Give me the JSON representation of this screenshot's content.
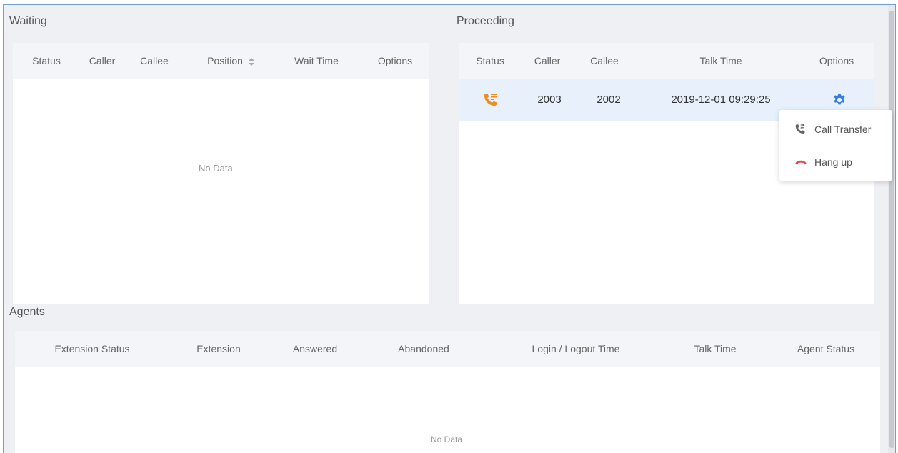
{
  "waiting": {
    "title": "Waiting",
    "columns": [
      "Status",
      "Caller",
      "Callee",
      "Position",
      "Wait Time",
      "Options"
    ],
    "sort_icon": "sort-icon",
    "empty_text": "No Data"
  },
  "proceeding": {
    "title": "Proceeding",
    "columns": [
      "Status",
      "Caller",
      "Callee",
      "Talk Time",
      "Options"
    ],
    "rows": [
      {
        "status_icon": "call-in-progress-icon",
        "caller": "2003",
        "callee": "2002",
        "talk_time": "2019-12-01 09:29:25",
        "options_icon": "gear-icon"
      }
    ]
  },
  "options_menu": {
    "items": [
      {
        "label": "Call Transfer",
        "icon": "call-transfer-icon"
      },
      {
        "label": "Hang up",
        "icon": "hang-up-icon"
      }
    ]
  },
  "agents": {
    "title": "Agents",
    "columns": [
      "Extension Status",
      "Extension",
      "Answered",
      "Abandoned",
      "Login / Logout Time",
      "Talk Time",
      "Agent Status"
    ],
    "empty_text": "No Data"
  },
  "colors": {
    "accent": "#3a7be0",
    "status_orange": "#f08c1a",
    "hangup_red": "#e04848",
    "border_blue": "#6f9fd8"
  }
}
